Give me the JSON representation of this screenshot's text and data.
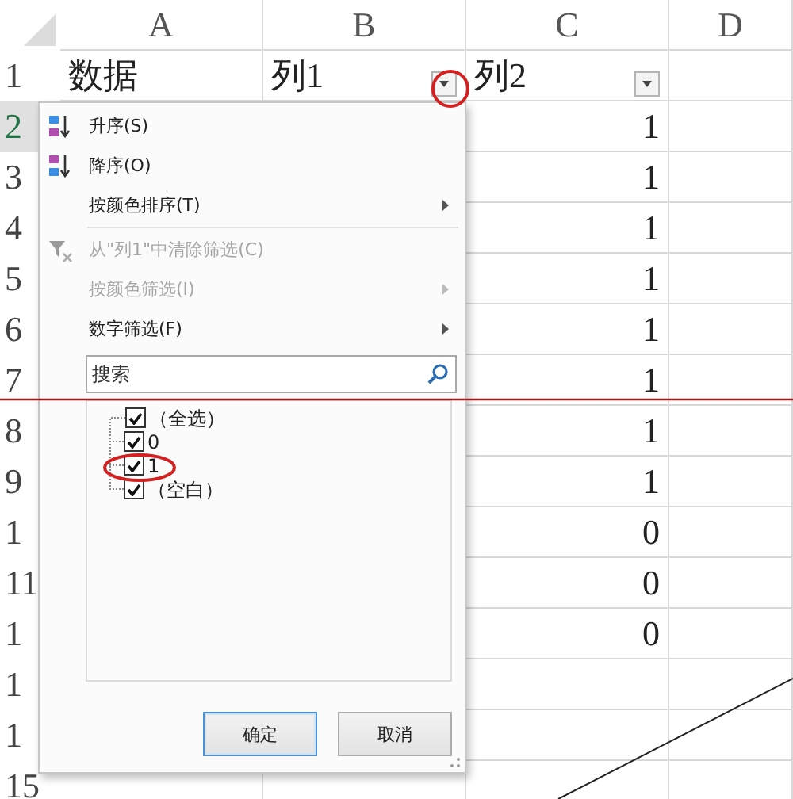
{
  "columns": [
    "A",
    "B",
    "C",
    "D"
  ],
  "header_row": {
    "header": "1",
    "cells": [
      {
        "text": "数据",
        "filter": false
      },
      {
        "text": "列1",
        "filter": true
      },
      {
        "text": "列2",
        "filter": true
      }
    ]
  },
  "rows": [
    {
      "header": "2",
      "selected": true,
      "value": "1"
    },
    {
      "header": "3",
      "selected": false,
      "value": "1"
    },
    {
      "header": "4",
      "selected": false,
      "value": "1"
    },
    {
      "header": "5",
      "selected": false,
      "value": "1"
    },
    {
      "header": "6",
      "selected": false,
      "value": "1"
    },
    {
      "header": "7",
      "selected": false,
      "value": "1"
    },
    {
      "header": "8",
      "selected": false,
      "value": "1"
    },
    {
      "header": "9",
      "selected": false,
      "value": "1"
    },
    {
      "header": "1",
      "selected": false,
      "value": "0"
    },
    {
      "header": "11",
      "selected": false,
      "value": "0"
    },
    {
      "header": "1",
      "selected": false,
      "value": "0"
    },
    {
      "header": "1",
      "selected": false
    },
    {
      "header": "1",
      "selected": false
    },
    {
      "header": "15",
      "selected": false
    }
  ],
  "filter_menu": {
    "items": [
      {
        "label": "升序(S)",
        "kind": "sort_asc",
        "disabled": false,
        "submenu": false
      },
      {
        "label": "降序(O)",
        "kind": "sort_desc",
        "disabled": false,
        "submenu": false
      },
      {
        "label": "按颜色排序(T)",
        "kind": "plain",
        "disabled": false,
        "submenu": true
      },
      {
        "label": "从\"列1\"中清除筛选(C)",
        "kind": "clear_filter",
        "disabled": true,
        "submenu": false
      },
      {
        "label": "按颜色筛选(I)",
        "kind": "plain",
        "disabled": true,
        "submenu": true
      },
      {
        "label": "数字筛选(F)",
        "kind": "plain",
        "disabled": false,
        "submenu": true
      }
    ],
    "search": {
      "placeholder": "搜索"
    },
    "values": [
      {
        "label": "（全选）",
        "checked": true
      },
      {
        "label": "0",
        "checked": true
      },
      {
        "label": "1",
        "checked": true
      },
      {
        "label": "（空白）",
        "checked": true
      }
    ],
    "buttons": [
      {
        "label": "确定",
        "default": true
      },
      {
        "label": "取消",
        "default": false
      }
    ]
  }
}
